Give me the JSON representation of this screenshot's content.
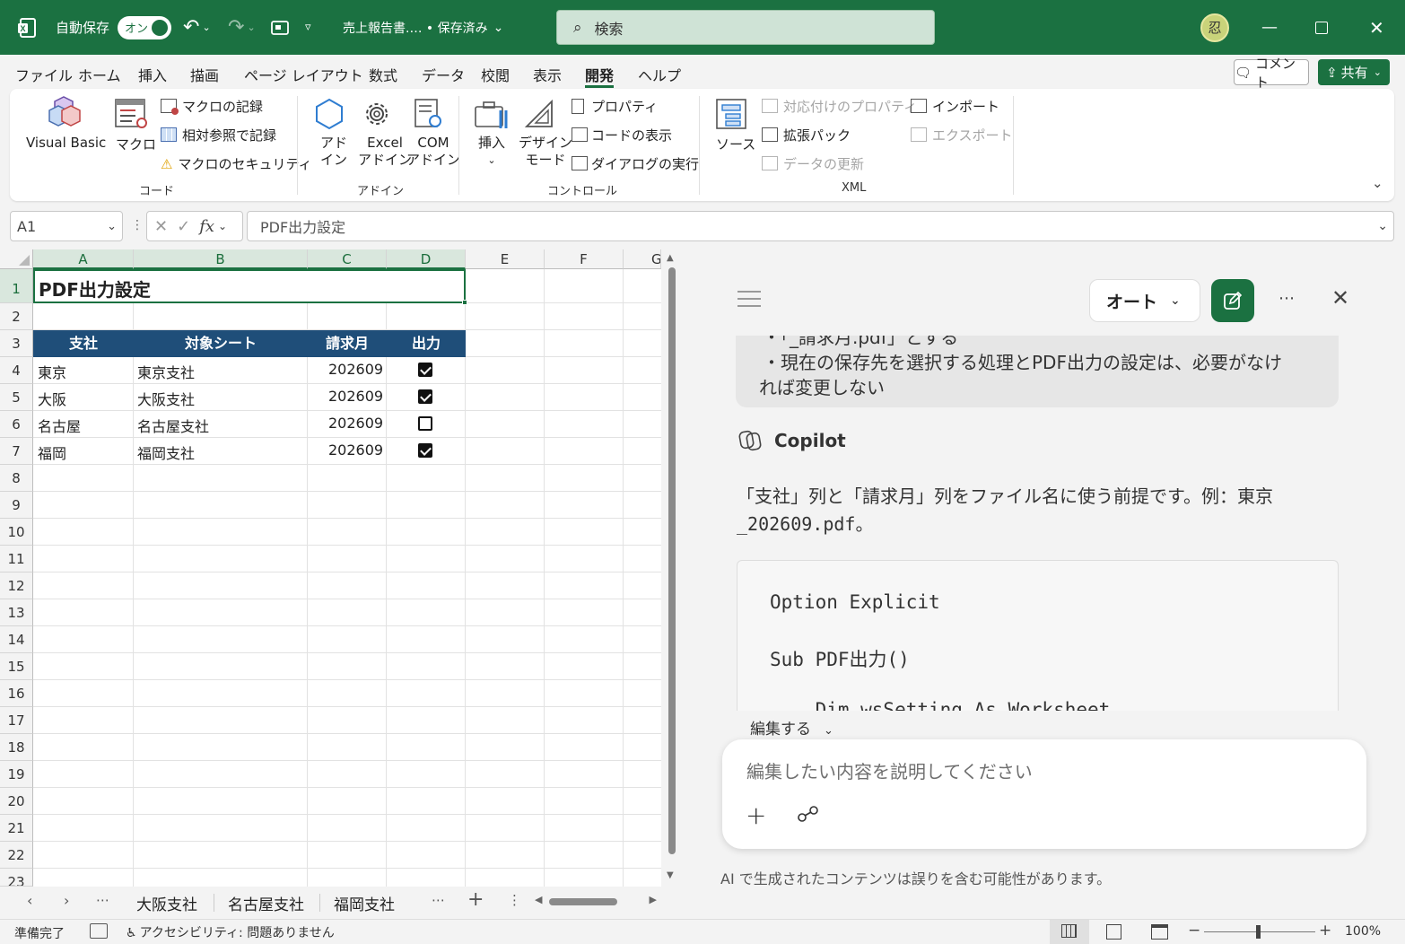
{
  "titlebar": {
    "autosave": "自動保存",
    "toggle": "オン",
    "docname": "売上報告書.… • 保存済み",
    "search": "検索"
  },
  "menu": [
    "ファイル",
    "ホーム",
    "挿入",
    "描画",
    "ページ レイアウト",
    "数式",
    "データ",
    "校閲",
    "表示",
    "開発",
    "ヘルプ"
  ],
  "menu_right": {
    "comment": "コメント",
    "share": "共有"
  },
  "ribbon": {
    "code": {
      "vb": "Visual Basic",
      "macro": "マクロ",
      "record": "マクロの記録",
      "relative": "相対参照で記録",
      "security": "マクロのセキュリティ",
      "group": "コード"
    },
    "addin": {
      "addin1": "アド",
      "addin2": "イン",
      "excel1": "Excel",
      "excel2": "アドイン",
      "com1": "COM",
      "com2": "アドイン",
      "group": "アドイン"
    },
    "control": {
      "insert": "挿入",
      "design1": "デザイン",
      "design2": "モード",
      "props": "プロパティ",
      "viewcode": "コードの表示",
      "dialog": "ダイアログの実行",
      "group": "コントロール"
    },
    "xml": {
      "source": "ソース",
      "mapprops": "対応付けのプロパティ",
      "expansion": "拡張パック",
      "refresh": "データの更新",
      "import": "インポート",
      "export": "エクスポート",
      "group": "XML"
    }
  },
  "formula": {
    "namebox": "A1",
    "value": "PDF出力設定"
  },
  "sheet": {
    "columns": [
      "A",
      "B",
      "C",
      "D",
      "E",
      "F",
      "G"
    ],
    "rows": [
      "1",
      "2",
      "3",
      "4",
      "5",
      "6",
      "7",
      "8",
      "9",
      "10",
      "11",
      "12",
      "13",
      "14",
      "15",
      "16",
      "17",
      "18",
      "19",
      "20",
      "21",
      "22",
      "23"
    ],
    "title": "PDF出力設定",
    "headers": [
      "支社",
      "対象シート",
      "請求月",
      "出力"
    ],
    "data": [
      {
        "branch": "東京",
        "sheet": "東京支社",
        "month": "202609",
        "output": true
      },
      {
        "branch": "大阪",
        "sheet": "大阪支社",
        "month": "202609",
        "output": true
      },
      {
        "branch": "名古屋",
        "sheet": "名古屋支社",
        "month": "202609",
        "output": false
      },
      {
        "branch": "福岡",
        "sheet": "福岡支社",
        "month": "202609",
        "output": true
      }
    ]
  },
  "tabs": [
    "大阪支社",
    "名古屋支社",
    "福岡支社"
  ],
  "copilot": {
    "mode": "オート",
    "prev_line0": "・「_請求月.pdf」とする",
    "prev_line1": "・現在の保存先を選択する処理とPDF出力の設定は、必要がなけ",
    "prev_line2": "れば変更しない",
    "name": "Copilot",
    "reply_line1": "「支社」列と「請求月」列をファイル名に使う前提です。例：東京",
    "reply_line2": "_202609.pdf。",
    "code1": "Option Explicit",
    "code2": "Sub PDF出力()",
    "code3": "    Dim wsSetting As Worksheet",
    "edit_label": "編集する",
    "input_placeholder": "編集したい内容を説明してください",
    "disclaimer": "AI で生成されたコンテンツは誤りを含む可能性があります。"
  },
  "status": {
    "ready": "準備完了",
    "accessibility": "アクセシビリティ: 問題ありません",
    "zoom": "100%"
  }
}
